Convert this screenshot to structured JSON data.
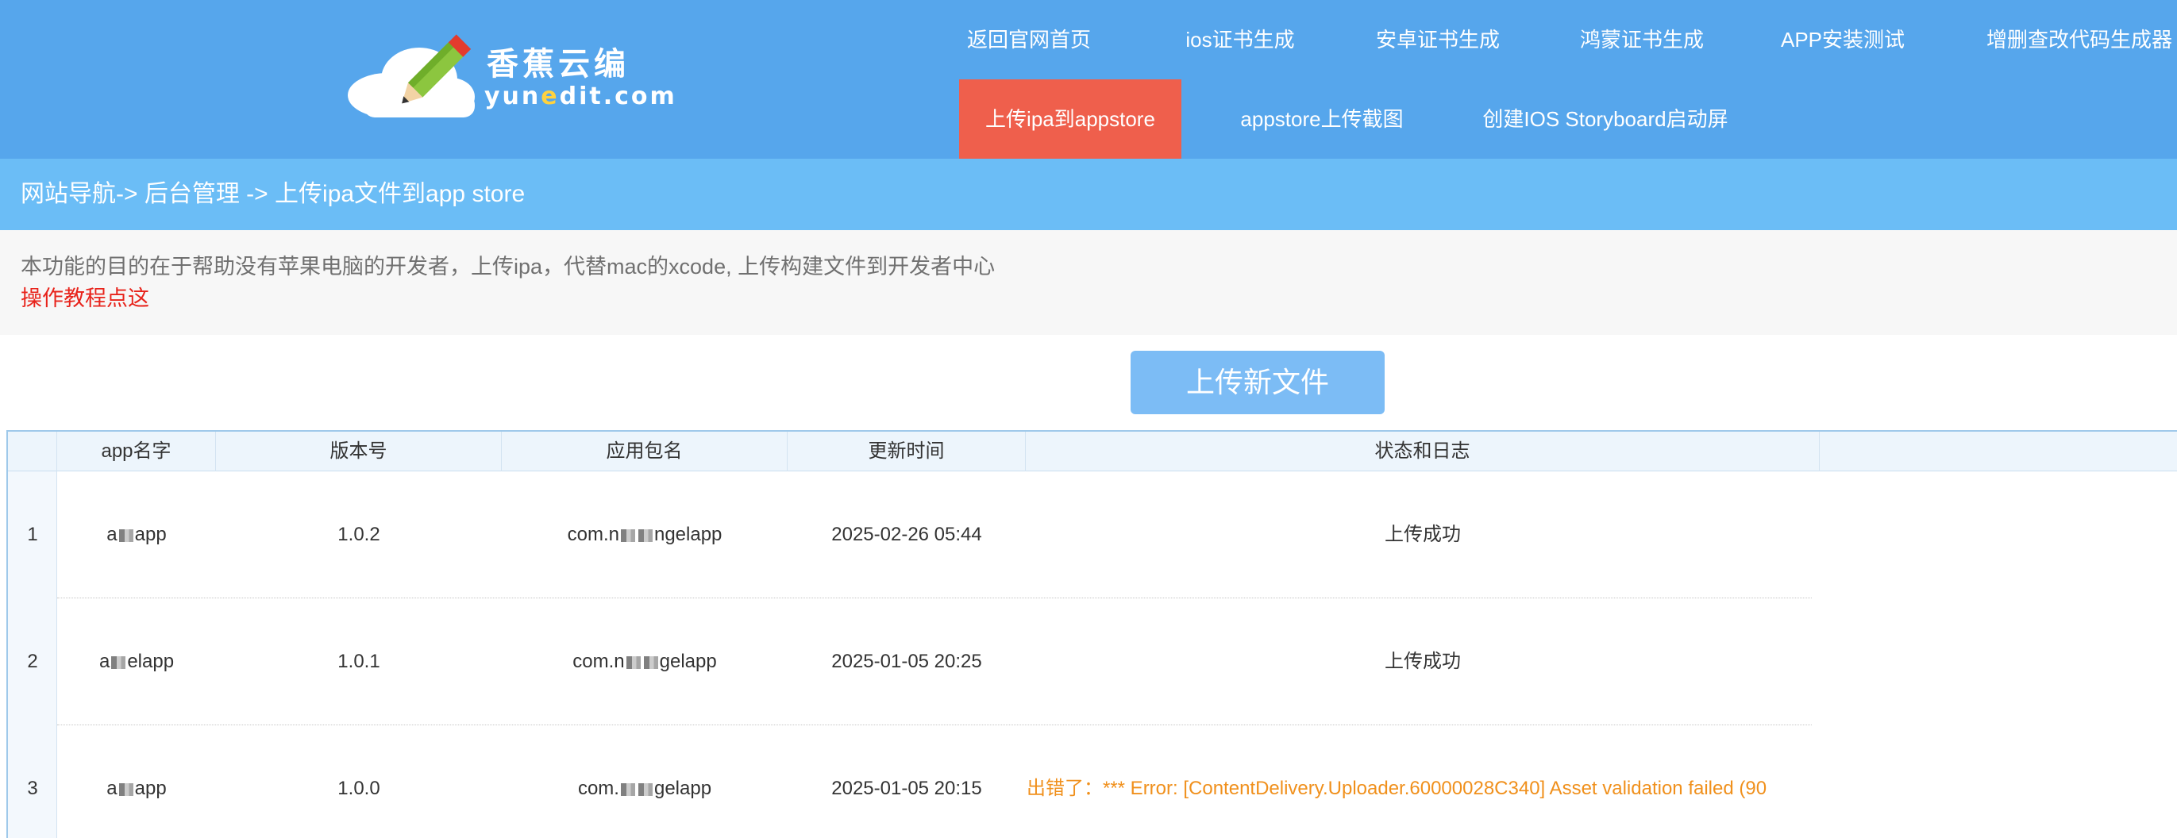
{
  "logo": {
    "cn": "香蕉云编",
    "en_pre": "yun",
    "en_e": "e",
    "en_post": "dit.com"
  },
  "nav": {
    "row1": [
      "返回官网首页",
      "ios证书生成",
      "安卓证书生成",
      "鸿蒙证书生成",
      "APP安装测试",
      "增删查改代码生成器"
    ],
    "row2": [
      "上传ipa到appstore",
      "appstore上传截图",
      "创建IOS Storyboard启动屏"
    ],
    "active": "上传ipa到appstore"
  },
  "breadcrumb": "网站导航-> 后台管理 -> 上传ipa文件到app store",
  "notice": {
    "text": "本功能的目的在于帮助没有苹果电脑的开发者，上传ipa，代替mac的xcode, 上传构建文件到开发者中心",
    "link": "操作教程点这"
  },
  "upload_button": "上传新文件",
  "table": {
    "headers": [
      "app名字",
      "版本号",
      "应用包名",
      "更新时间",
      "状态和日志"
    ],
    "rows": [
      {
        "num": "1",
        "app_pre": "a",
        "app_post": "app",
        "version": "1.0.2",
        "pkg_pre": "com.n",
        "pkg_post": "ngelapp",
        "time": "2025-02-26 05:44",
        "status": "上传成功",
        "status_type": "ok"
      },
      {
        "num": "2",
        "app_pre": "a",
        "app_post": "elapp",
        "version": "1.0.1",
        "pkg_pre": "com.n",
        "pkg_post": "gelapp",
        "time": "2025-01-05 20:25",
        "status": "上传成功",
        "status_type": "ok"
      },
      {
        "num": "3",
        "app_pre": "a",
        "app_post": "app",
        "version": "1.0.0",
        "pkg_pre": "com.",
        "pkg_post": "gelapp",
        "time": "2025-01-05 20:15",
        "status": "出错了：*** Error: [ContentDelivery.Uploader.60000028C340] Asset validation failed (90",
        "status_type": "error"
      }
    ]
  },
  "colors": {
    "header": "#56a6ec",
    "active_nav": "#ef5f4c",
    "breadcrumb": "#6bbdf6",
    "button": "#7cbcf5",
    "error": "#f0901c",
    "link": "#e8231b"
  }
}
